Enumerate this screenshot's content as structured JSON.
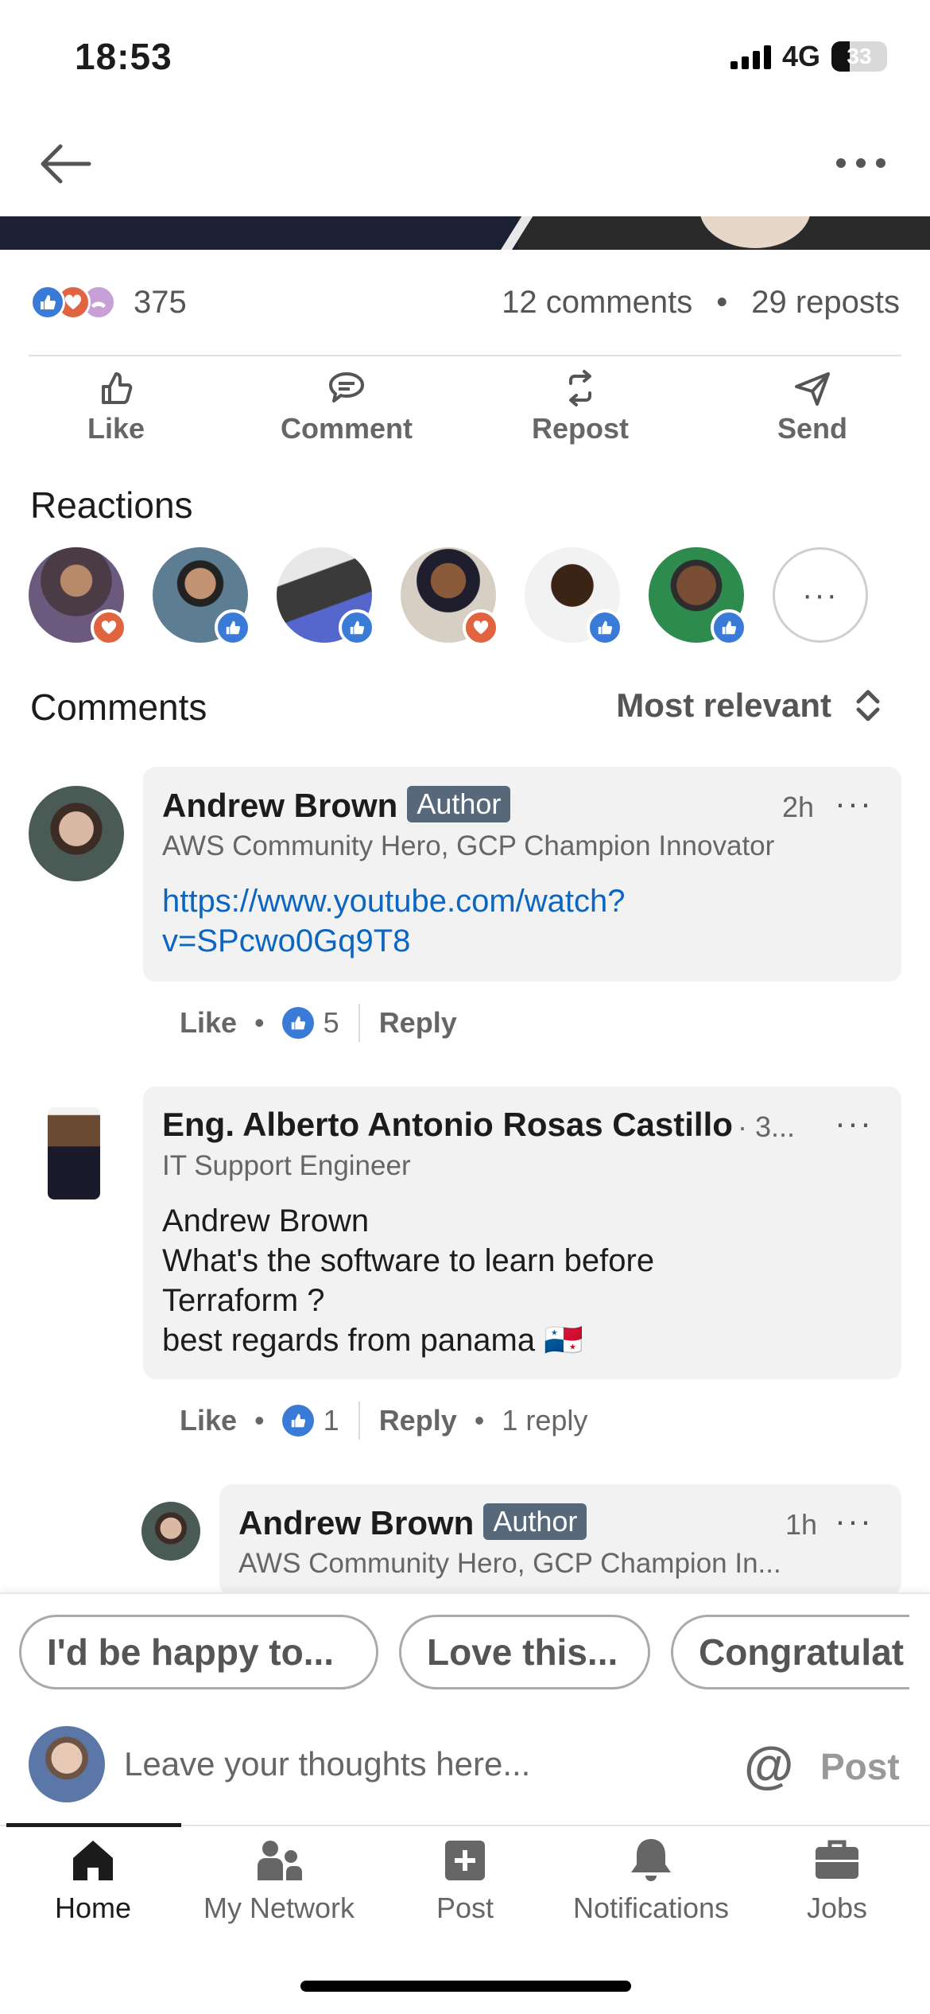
{
  "status_bar": {
    "time": "18:53",
    "network": "4G",
    "battery": "33",
    "battery_level": 0.33
  },
  "post_social": {
    "reactions_count": "375",
    "comments_count": "12 comments",
    "separator": "•",
    "reposts_count": "29 reposts"
  },
  "actions": [
    {
      "label": "Like",
      "icon": "thumbs-up-icon"
    },
    {
      "label": "Comment",
      "icon": "comment-icon"
    },
    {
      "label": "Repost",
      "icon": "repost-icon"
    },
    {
      "label": "Send",
      "icon": "send-icon"
    }
  ],
  "reactions": {
    "title": "Reactions",
    "reactors": [
      {
        "reaction": "love"
      },
      {
        "reaction": "like"
      },
      {
        "reaction": "like"
      },
      {
        "reaction": "love"
      },
      {
        "reaction": "like"
      },
      {
        "reaction": "like"
      }
    ],
    "more_label": "···"
  },
  "comments": {
    "title": "Comments",
    "sort_label": "Most relevant",
    "items": [
      {
        "name": "Andrew Brown",
        "badge": "Author",
        "headline": "AWS Community Hero, GCP Champion Innovator",
        "time": "2h",
        "link_line1": "https://www.youtube.com/watch?",
        "link_line2": "v=SPcwo0Gq9T8",
        "like_label": "Like",
        "like_count": "5",
        "reply_label": "Reply"
      },
      {
        "name": "Eng. Alberto Antonio Rosas Castillo",
        "time": "· 3...",
        "headline": "IT Support Engineer",
        "body_lines": [
          "Andrew Brown",
          "What's the software to learn before",
          "Terraform ?",
          "best regards from panama 🇵🇦"
        ],
        "like_label": "Like",
        "like_count": "1",
        "reply_label": "Reply",
        "replies_label": "1 reply"
      },
      {
        "name": "Andrew Brown",
        "badge": "Author",
        "headline": "AWS Community Hero, GCP Champion In...",
        "time": "1h"
      }
    ]
  },
  "quick_replies": [
    "I'd be happy to...",
    "Love this...",
    "Congratulat"
  ],
  "composer": {
    "placeholder": "Leave your thoughts here...",
    "mention_symbol": "@",
    "post_label": "Post"
  },
  "tabs": [
    {
      "label": "Home",
      "icon": "home-icon",
      "active": true
    },
    {
      "label": "My Network",
      "icon": "network-icon",
      "active": false
    },
    {
      "label": "Post",
      "icon": "plus-square-icon",
      "active": false
    },
    {
      "label": "Notifications",
      "icon": "bell-icon",
      "active": false
    },
    {
      "label": "Jobs",
      "icon": "briefcase-icon",
      "active": false
    }
  ],
  "colors": {
    "link": "#0a66c2",
    "like": "#3b7bd8",
    "love": "#e0643f",
    "author_badge": "#56687a"
  }
}
